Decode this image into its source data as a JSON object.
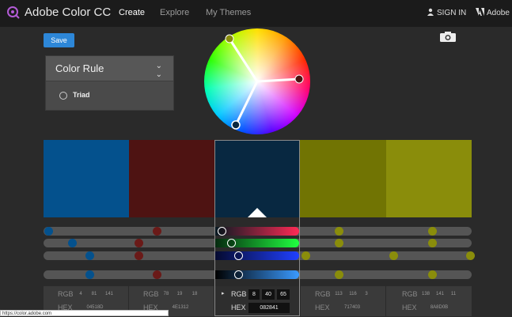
{
  "header": {
    "brand": "Adobe Color CC",
    "nav": [
      "Create",
      "Explore",
      "My Themes"
    ],
    "signin": "SIGN IN",
    "adobe": "Adobe"
  },
  "toolbar": {
    "save_label": "Save"
  },
  "color_rule": {
    "title": "Color Rule",
    "selected": "Triad"
  },
  "swatches": [
    {
      "hex": "04518D",
      "rgb": [
        "4",
        "81",
        "141"
      ],
      "color": "#04518D"
    },
    {
      "hex": "4E1312",
      "rgb": [
        "78",
        "19",
        "18"
      ],
      "color": "#4E1312"
    },
    {
      "hex": "082841",
      "rgb": [
        "8",
        "40",
        "65"
      ],
      "color": "#082841"
    },
    {
      "hex": "717403",
      "rgb": [
        "113",
        "116",
        "3"
      ],
      "color": "#717403"
    },
    {
      "hex": "8A8D0B",
      "rgb": [
        "138",
        "141",
        "11"
      ],
      "color": "#8A8D0B"
    }
  ],
  "labels": {
    "rgb": "RGB",
    "hex": "HEX"
  },
  "status_url": "https://color.adobe.com"
}
